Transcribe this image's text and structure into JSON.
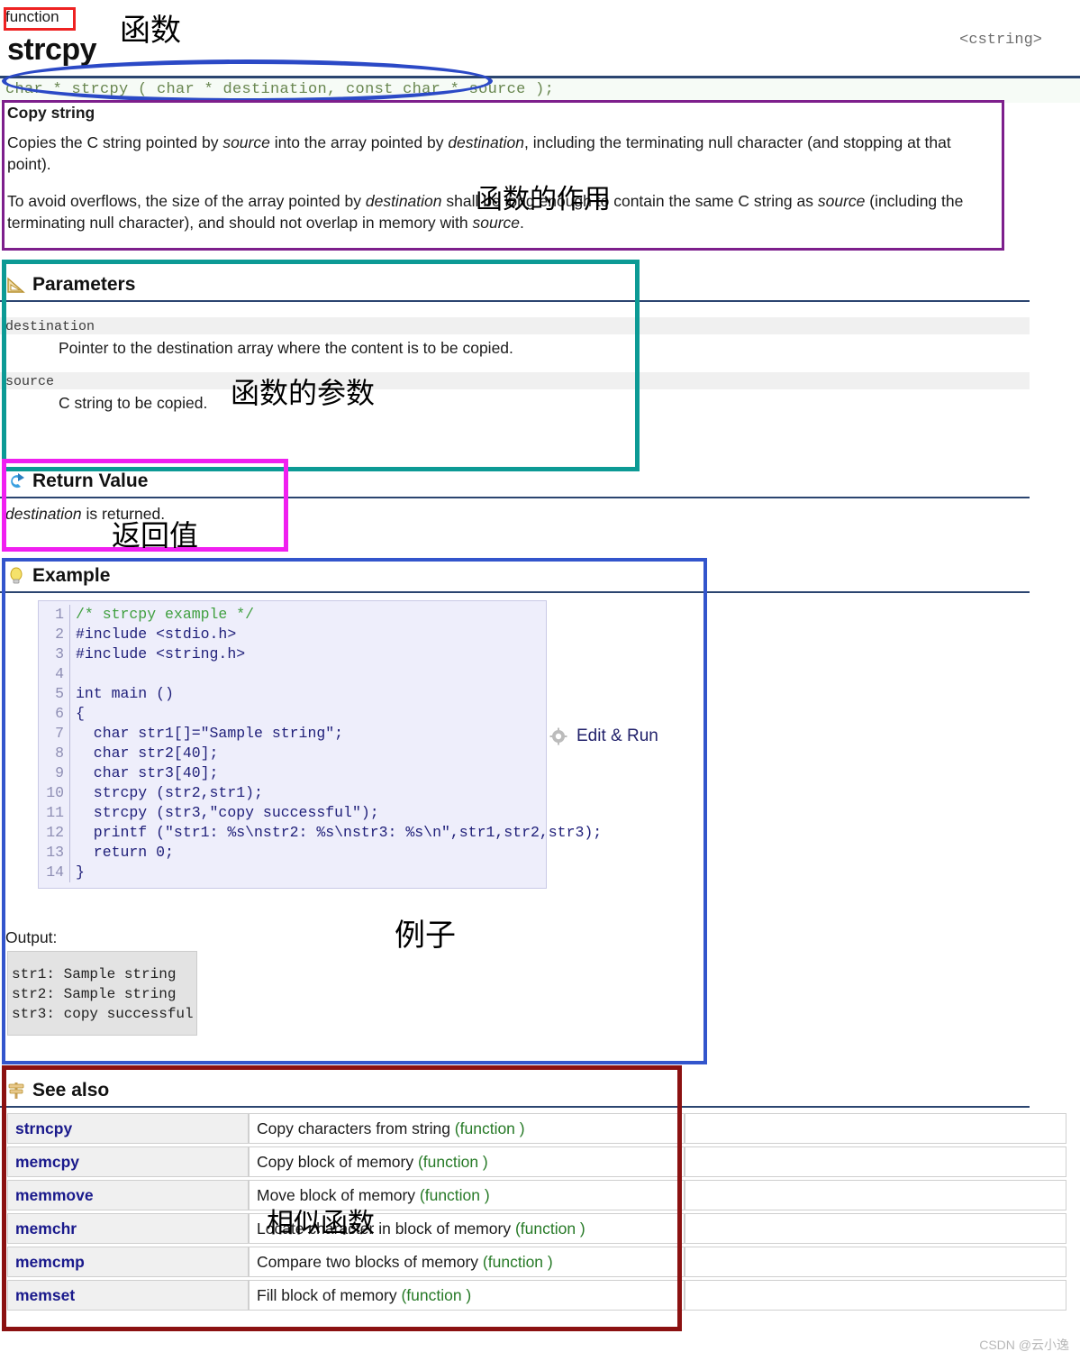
{
  "header": {
    "kind_tag": "function",
    "function_name": "strcpy",
    "include_header": "<cstring>",
    "signature": "char * strcpy ( char * destination, const char * source );"
  },
  "description": {
    "title": "Copy string",
    "paragraph1_a": "Copies the C string pointed by ",
    "paragraph1_src": "source",
    "paragraph1_b": " into the array pointed by ",
    "paragraph1_dst": "destination",
    "paragraph1_c": ", including the terminating null character (and stopping at that point).",
    "paragraph2_a": "To avoid overflows, the size of the array pointed by ",
    "paragraph2_dst": "destination",
    "paragraph2_b": " shall be long enough to contain the same C string as ",
    "paragraph2_src": "source",
    "paragraph2_c": " (including the terminating null character), and should not overlap in memory with ",
    "paragraph2_src2": "source",
    "paragraph2_d": "."
  },
  "sections": {
    "parameters": {
      "title": "Parameters",
      "icon": "ruler-triangle-icon"
    },
    "return_value": {
      "title": "Return Value",
      "icon": "return-arrow-icon"
    },
    "example": {
      "title": "Example",
      "icon": "lightbulb-icon"
    },
    "see_also": {
      "title": "See also",
      "icon": "signpost-icon"
    }
  },
  "parameters": [
    {
      "name": "destination",
      "description": "Pointer to the destination array where the content is to be copied."
    },
    {
      "name": "source",
      "description": "C string to be copied."
    }
  ],
  "return_value": {
    "emphasis": "destination",
    "rest": " is returned."
  },
  "example": {
    "lines": [
      {
        "n": "1",
        "code": "/* strcpy example */",
        "comment": true
      },
      {
        "n": "2",
        "code": "#include <stdio.h>",
        "comment": false
      },
      {
        "n": "3",
        "code": "#include <string.h>",
        "comment": false
      },
      {
        "n": "4",
        "code": "",
        "comment": false
      },
      {
        "n": "5",
        "code": "int main ()",
        "comment": false
      },
      {
        "n": "6",
        "code": "{",
        "comment": false
      },
      {
        "n": "7",
        "code": "  char str1[]=\"Sample string\";",
        "comment": false
      },
      {
        "n": "8",
        "code": "  char str2[40];",
        "comment": false
      },
      {
        "n": "9",
        "code": "  char str3[40];",
        "comment": false
      },
      {
        "n": "10",
        "code": "  strcpy (str2,str1);",
        "comment": false
      },
      {
        "n": "11",
        "code": "  strcpy (str3,\"copy successful\");",
        "comment": false
      },
      {
        "n": "12",
        "code": "  printf (\"str1: %s\\nstr2: %s\\nstr3: %s\\n\",str1,str2,str3);",
        "comment": false
      },
      {
        "n": "13",
        "code": "  return 0;",
        "comment": false
      },
      {
        "n": "14",
        "code": "}",
        "comment": false
      }
    ],
    "edit_run_label": "Edit & Run",
    "output_label": "Output:",
    "output_text": "str1: Sample string\nstr2: Sample string\nstr3: copy successful"
  },
  "see_also": [
    {
      "name": "strncpy",
      "desc": "Copy characters from string ",
      "kind": "(function )"
    },
    {
      "name": "memcpy",
      "desc": "Copy block of memory ",
      "kind": "(function )"
    },
    {
      "name": "memmove",
      "desc": "Move block of memory ",
      "kind": "(function )"
    },
    {
      "name": "memchr",
      "desc": "Locate character in block of memory ",
      "kind": "(function )"
    },
    {
      "name": "memcmp",
      "desc": "Compare two blocks of memory ",
      "kind": "(function )"
    },
    {
      "name": "memset",
      "desc": "Fill block of memory ",
      "kind": "(function )"
    }
  ],
  "annotations": {
    "function_label": "函数",
    "purpose_label": "函数的作用",
    "parameters_label": "函数的参数",
    "return_label": "返回值",
    "example_label": "例子",
    "similar_label": "相似函数"
  },
  "colors": {
    "red_box": "#ee2222",
    "blue_ellipse": "#2b49c6",
    "purple_box": "#7d1f8c",
    "teal_box": "#0c9a95",
    "magenta_box": "#f01ff0",
    "blue_box": "#3355cc",
    "darkred_box": "#8b1111"
  },
  "watermark": "CSDN @云小逸"
}
